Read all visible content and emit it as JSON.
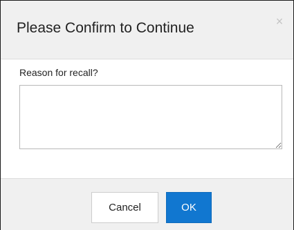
{
  "dialog": {
    "title": "Please Confirm to Continue",
    "close_glyph": "×",
    "close_icon": "close-icon",
    "reason_label": "Reason for recall?",
    "reason_value": "",
    "cancel_label": "Cancel",
    "ok_label": "OK"
  },
  "colors": {
    "header_bg": "#f0f0f0",
    "footer_bg": "#f0f0f0",
    "primary": "#1177d0",
    "text": "#222222"
  }
}
